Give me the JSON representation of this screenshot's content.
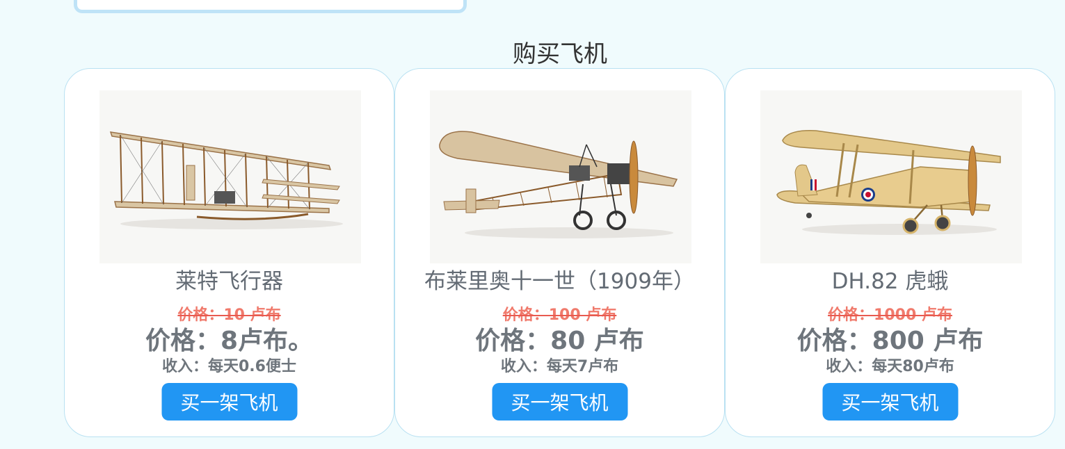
{
  "section": {
    "title": "购买飞机"
  },
  "cards": [
    {
      "name": "莱特飞行器",
      "old_price": "价格：10 卢布",
      "new_price": "价格：8卢布。",
      "income": "收入：每天0.6便士",
      "button": "买一架飞机",
      "image_icon": "wright-flyer-image"
    },
    {
      "name": "布莱里奥十一世（1909年）",
      "old_price": "价格：100 卢布",
      "new_price": "价格：80 卢布",
      "income": "收入：每天7卢布",
      "button": "买一架飞机",
      "image_icon": "bleriot-xi-image"
    },
    {
      "name": "DH.82 虎蛾",
      "old_price": "价格：1000 卢布",
      "new_price": "价格：800 卢布",
      "income": "收入：每天80卢布",
      "button": "买一架飞机",
      "image_icon": "tiger-moth-image"
    }
  ],
  "colors": {
    "background": "#f0fbfd",
    "card_border": "#b9e1f2",
    "button": "#2196f3",
    "old_price": "#f07a6c",
    "text": "#6e757c"
  }
}
